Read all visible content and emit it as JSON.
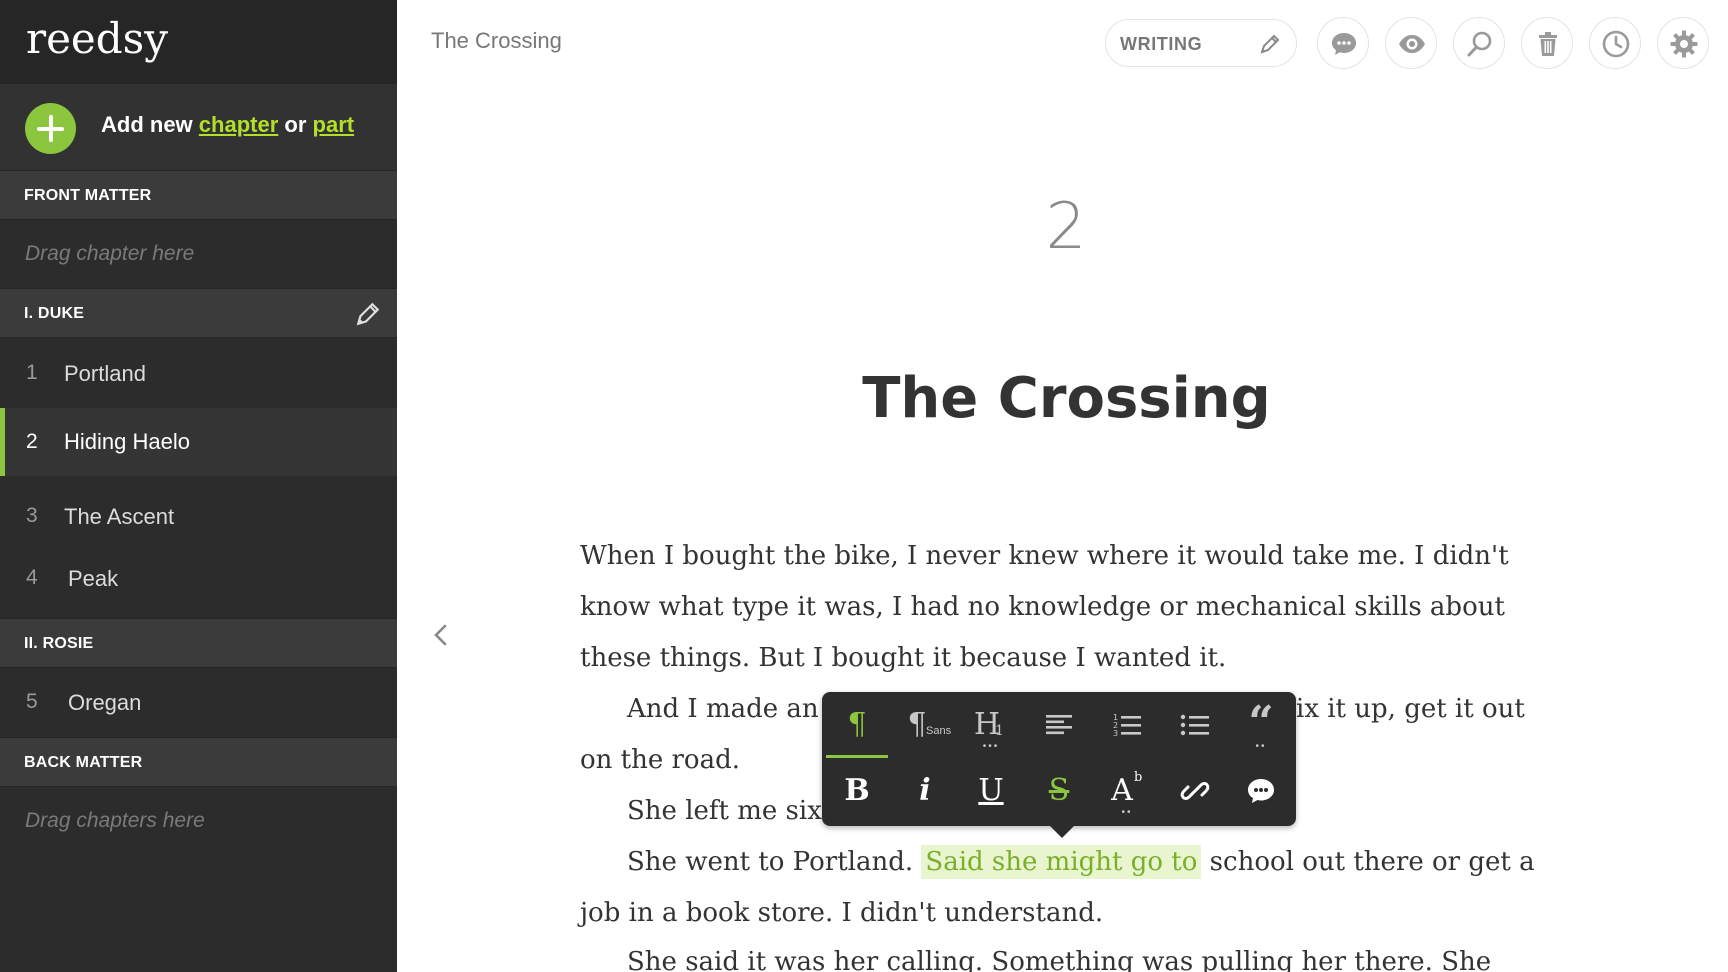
{
  "sidebar": {
    "logo": "reedsy",
    "add_new": {
      "prefix": "Add new",
      "chapter_link": "chapter",
      "or": "or",
      "part_link": "part"
    },
    "front_matter": {
      "label": "FRONT MATTER",
      "drop_hint": "Drag chapter here"
    },
    "parts": [
      {
        "label": "I. DUKE"
      },
      {
        "label": "II. ROSIE"
      }
    ],
    "chapters": [
      {
        "num": "1",
        "name": "Portland"
      },
      {
        "num": "2",
        "name": "Hiding Haelo"
      },
      {
        "num": "3",
        "name": "The Ascent"
      },
      {
        "num": "4",
        "name": "Peak"
      },
      {
        "num": "5",
        "name": "Oregan"
      }
    ],
    "back_matter": {
      "label": "BACK MATTER",
      "drop_hint": "Drag chapters here"
    }
  },
  "topbar": {
    "doc_title": "The Crossing",
    "mode_label": "WRITING"
  },
  "content": {
    "chapter_number": "2",
    "chapter_title": "The Crossing",
    "lines": [
      "When I bought the bike, I never knew where it would take me. I didn't",
      "know what type it was, I had no knowledge or mechanical skills about",
      "these things. But I bought it because I wanted it.",
      "And I made an",
      "ix it up, get it out",
      "on the road.",
      "She left me six",
      "She went to Portland.",
      "Said she might go to",
      "school out there or get a",
      "job in a book store. I didn't understand.",
      "She said it was her calling. Something was pulling her there. She"
    ]
  },
  "toolbar": {
    "paragraph": "¶",
    "sans": "Sans",
    "heading": "H",
    "heading_sub": "1",
    "bold": "B",
    "italic": "i",
    "underline": "U",
    "strike": "S",
    "superscript_base": "A",
    "superscript_sup": "b",
    "quote": "“"
  },
  "colors": {
    "accent": "#8cc63f",
    "sidebar_bg": "#2c2c2c",
    "highlight_bg": "#e8f5cf",
    "highlight_text": "#7bae2a"
  }
}
